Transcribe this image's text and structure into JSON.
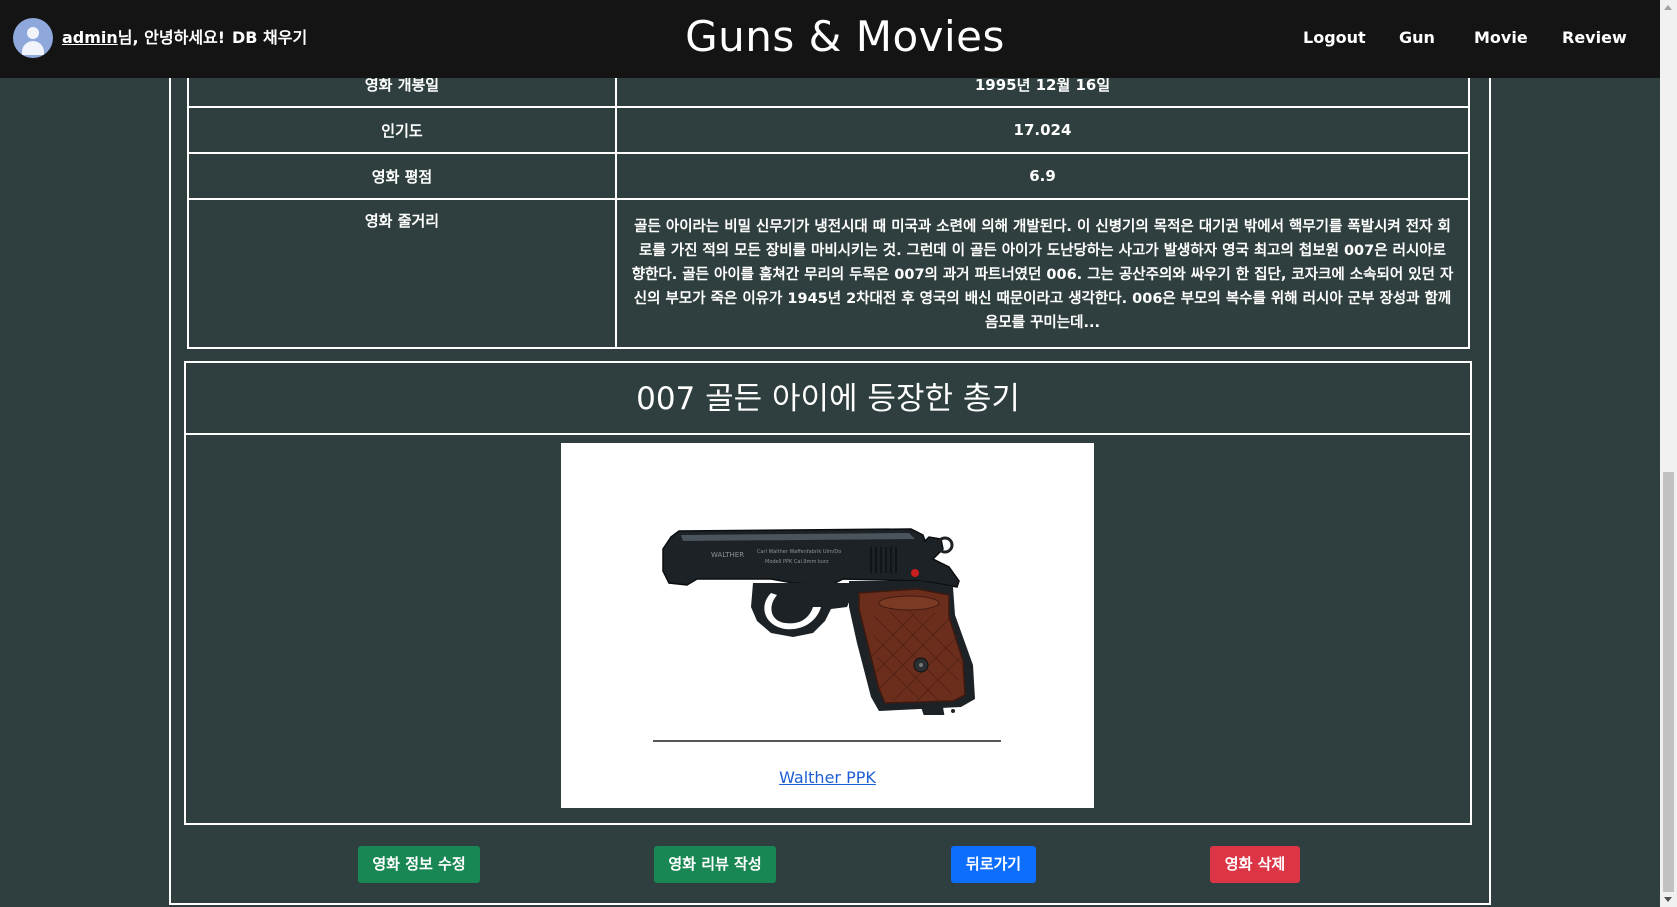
{
  "navbar": {
    "username": "admin",
    "greeting_suffix": "님, 안녕하세요!",
    "db_fill_label": "DB 채우기",
    "brand": "Guns & Movies",
    "links": {
      "logout": "Logout",
      "gun": "Gun",
      "movie": "Movie",
      "review": "Review"
    }
  },
  "movie_info": {
    "release_date_label": "영화 개봉일",
    "release_date_value": "1995년 12월 16일",
    "popularity_label": "인기도",
    "popularity_value": "17.024",
    "rating_label": "영화 평점",
    "rating_value": "6.9",
    "plot_label": "영화 줄거리",
    "plot_value": "골든 아이라는 비밀 신무기가 냉전시대 때 미국과 소련에 의해 개발된다. 이 신병기의 목적은 대기권 밖에서 핵무기를 폭발시켜 전자 회로를 가진 적의 모든 장비를 마비시키는 것. 그런데 이 골든 아이가 도난당하는 사고가 발생하자 영국 최고의 첩보원 007은 러시아로 향한다. 골든 아이를 훔쳐간 무리의 두목은 007의 과거 파트너였던 006. 그는 공산주의와 싸우기 한 집단, 코자크에 소속되어 있던 자신의 부모가 죽은 이유가 1945년 2차대전 후 영국의 배신 때문이라고 생각한다. 006은 부모의 복수를 위해 러시아 군부 장성과 함께 음모를 꾸미는데..."
  },
  "guns_section": {
    "title": "007 골든 아이에 등장한 총기",
    "guns": [
      {
        "name": "Walther PPK",
        "icon": "pistol-image"
      }
    ]
  },
  "actions": {
    "edit_label": "영화 정보 수정",
    "review_label": "영화 리뷰 작성",
    "back_label": "뒤로가기",
    "delete_label": "영화 삭제"
  },
  "colors": {
    "page_bg": "#2f3e3e",
    "navbar_bg": "#141414",
    "success": "#198754",
    "primary": "#0d6efd",
    "danger": "#dc3545",
    "link": "#1f5fd6"
  }
}
